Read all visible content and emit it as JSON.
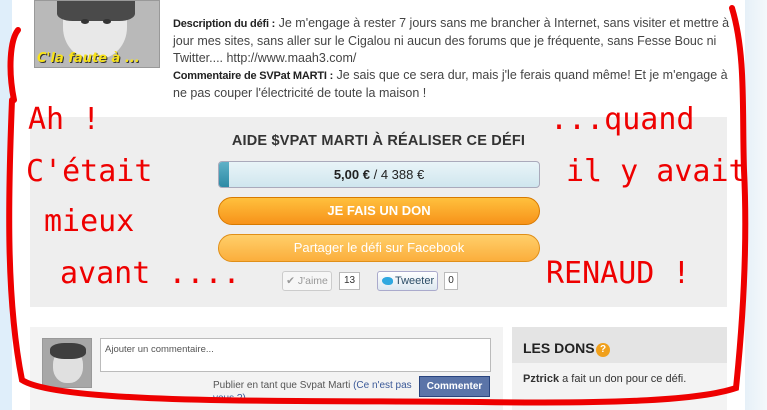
{
  "defi": {
    "avatar_caption": "C'la faute à ...",
    "description_label": "Description du défi :",
    "description_text": " Je m'engage à rester 7 jours sans me brancher à Internet, sans visiter et mettre à jour mes sites, sans aller sur le Cigalou ni aucun des forums que je fréquente, sans Fesse Bouc ni Twitter.... http://www.maah3.com/",
    "comment_label": "Commentaire de SVPat MARTI :",
    "comment_text": " Je sais que ce sera dur, mais j'le ferais quand même! Et je m'engage à ne pas couper l'électricité de toute la maison !"
  },
  "aide": {
    "title": "AIDE $VPAT MARTI À RÉALISER CE DÉFI",
    "raised": "5,00 €",
    "separator": " / ",
    "goal": "4 388 €",
    "progress_fraction": 0.0011,
    "don_button": "JE FAIS UN DON",
    "facebook_button": "Partager le défi sur Facebook",
    "like_label": "J'aime",
    "like_count": "13",
    "tweet_label": "Tweeter",
    "tweet_count": "0"
  },
  "comments": {
    "placeholder": "Ajouter un commentaire...",
    "publish_prefix": "Publier en tant que Svpat Marti ",
    "publish_link": "(Ce n'est pas vous ?)",
    "submit_button": "Commenter"
  },
  "dons": {
    "title": "LES DONS",
    "icon": "?",
    "donor": "Pztrick",
    "entry_text": " a fait un don pour ce défi."
  },
  "annotation": {
    "left_line1": "Ah !",
    "left_line2": "C'était",
    "left_line3": "mieux",
    "left_line4": "avant ....",
    "right_line1": "...quand",
    "right_line2": "il y avait",
    "right_line3": "RENAUD !",
    "color": "#ee0000"
  }
}
